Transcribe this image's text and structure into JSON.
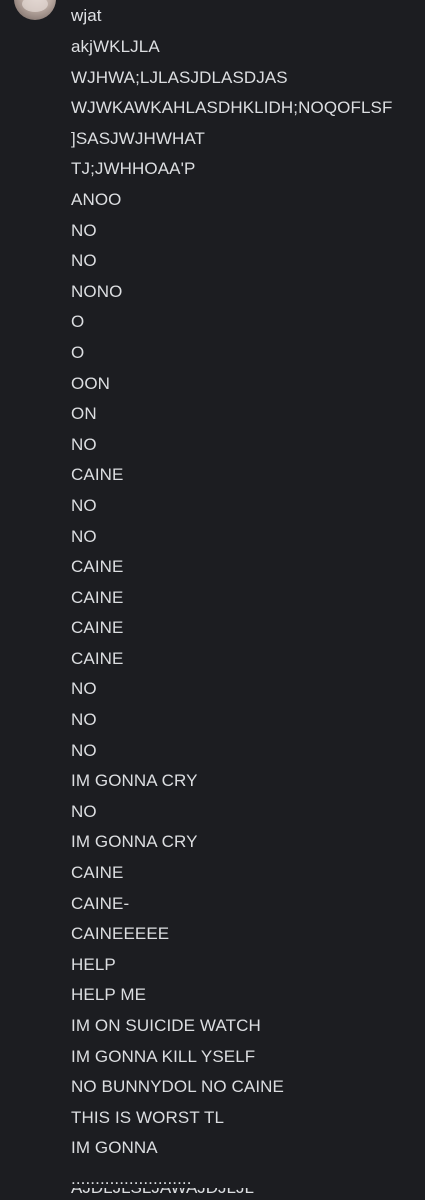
{
  "message": {
    "username": "wjat",
    "lines": [
      "akjWKLJLA",
      "WJHWA;LJLASJDLASDJAS",
      "WJWKAWKAHLASDHKLIDH;NOQOFLSF",
      "]SASJWJHWHAT",
      "TJ;JWHHOAA'P",
      "ANOO",
      "NO",
      "NO",
      "NONO",
      "O",
      "O",
      "OON",
      "ON",
      "NO",
      "CAINE",
      "NO",
      "NO",
      "CAINE",
      "CAINE",
      "CAINE",
      "CAINE",
      "NO",
      "NO",
      "NO",
      "IM GONNA CRY",
      "NO",
      "IM GONNA CRY",
      "CAINE",
      "CAINE-",
      "CAINEEEEE",
      "HELP",
      "HELP ME",
      "IM ON SUICIDE WATCH",
      "IM GONNA KILL YSELF",
      "NO BUNNYDOL NO CAINE",
      "THIS IS WORST TL",
      "IM GONNA",
      "........................."
    ],
    "cut_off_line": "AJDLJLSLJAWAJDJLJL"
  }
}
